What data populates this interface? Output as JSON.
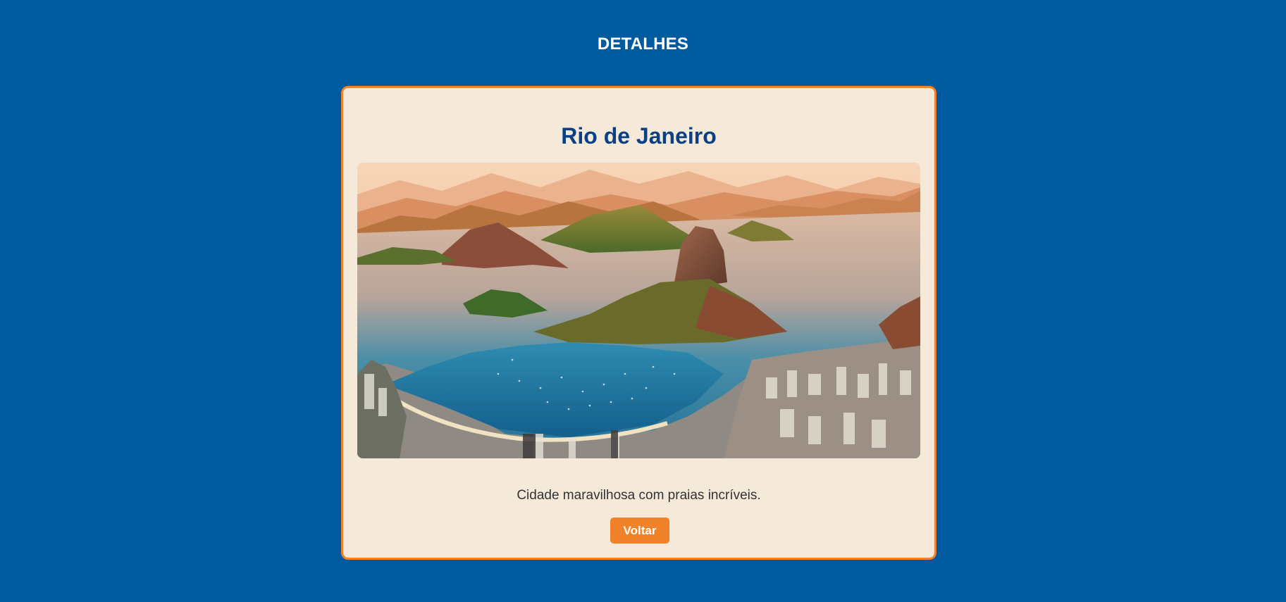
{
  "header": {
    "title": "DETALHES"
  },
  "destination": {
    "name": "Rio de Janeiro",
    "image_subject": "Rio de Janeiro aerial landscape with Sugarloaf Mountain and bay",
    "description": "Cidade maravilhosa com praias incríveis.",
    "back_label": "Voltar"
  },
  "colors": {
    "background": "#005a9e",
    "card_background": "#f5ead9",
    "accent": "#f0822a",
    "title_blue": "#0b3f86"
  }
}
